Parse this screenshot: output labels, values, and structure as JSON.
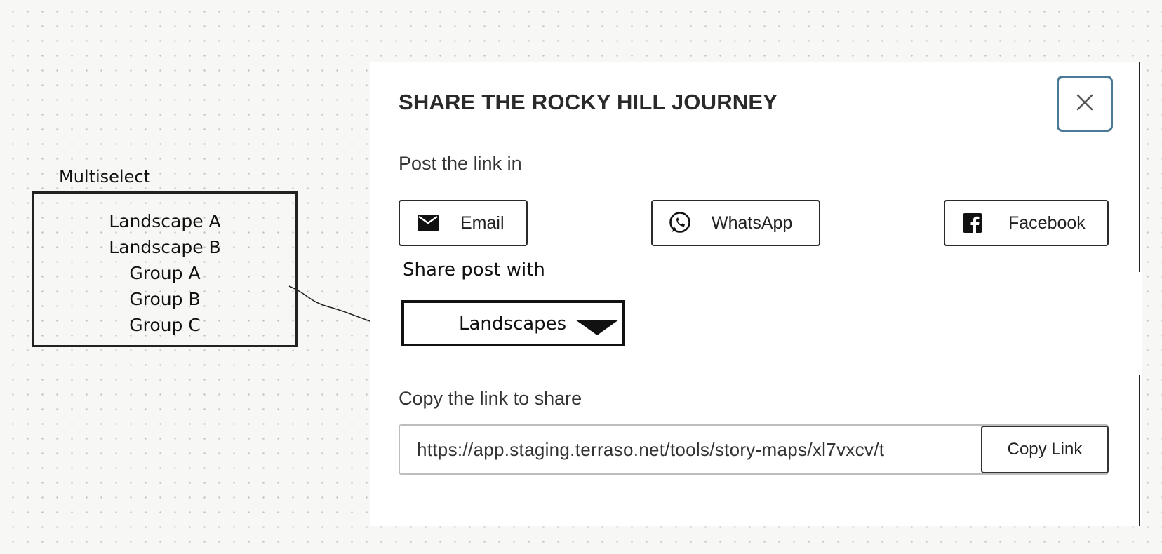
{
  "annotation": {
    "title": "Multiselect",
    "options": [
      "Landscape A",
      "Landscape B",
      "Group A",
      "Group B",
      "Group C"
    ]
  },
  "dialog": {
    "title": "SHARE THE ROCKY HILL JOURNEY",
    "close_icon": "close-icon",
    "post_label": "Post the link in",
    "share_buttons": [
      {
        "label": "Email",
        "icon": "email-icon"
      },
      {
        "label": "WhatsApp",
        "icon": "whatsapp-icon"
      },
      {
        "label": "Facebook",
        "icon": "facebook-icon"
      }
    ],
    "share_with_label": "Share post with",
    "share_with_value": "Landscapes",
    "copy_label": "Copy the link to share",
    "link_value": "https://app.staging.terraso.net/tools/story-maps/xl7vxcv/t",
    "copy_button": "Copy Link"
  }
}
